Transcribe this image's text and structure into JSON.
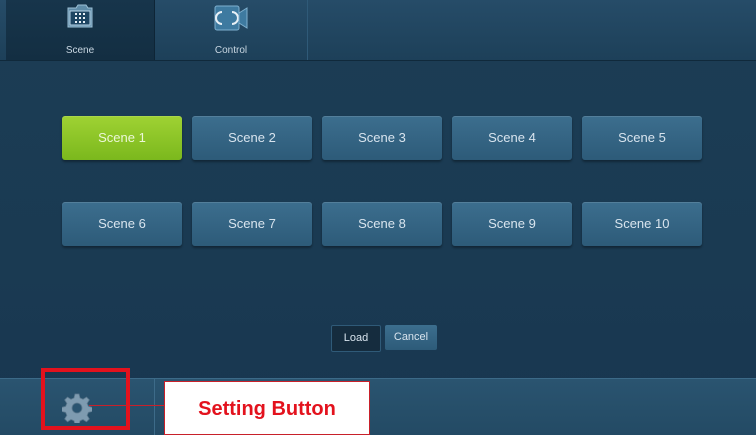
{
  "tabs": [
    {
      "label": "Scene",
      "icon": "keypad-icon",
      "active": true
    },
    {
      "label": "Control",
      "icon": "control-icon",
      "active": false
    }
  ],
  "scenes": [
    {
      "label": "Scene 1",
      "active": true
    },
    {
      "label": "Scene 2",
      "active": false
    },
    {
      "label": "Scene 3",
      "active": false
    },
    {
      "label": "Scene 4",
      "active": false
    },
    {
      "label": "Scene 5",
      "active": false
    },
    {
      "label": "Scene 6",
      "active": false
    },
    {
      "label": "Scene 7",
      "active": false
    },
    {
      "label": "Scene 8",
      "active": false
    },
    {
      "label": "Scene 9",
      "active": false
    },
    {
      "label": "Scene 10",
      "active": false
    }
  ],
  "actions": {
    "load_label": "Load",
    "cancel_label": "Cancel"
  },
  "bottom": {
    "settings_icon": "gear-icon"
  },
  "annotation": {
    "callout_text": "Setting Button",
    "color": "#e3121d"
  },
  "colors": {
    "active_scene": "#8cc52a",
    "scene_button": "#34658a",
    "background": "#1b3b53"
  }
}
